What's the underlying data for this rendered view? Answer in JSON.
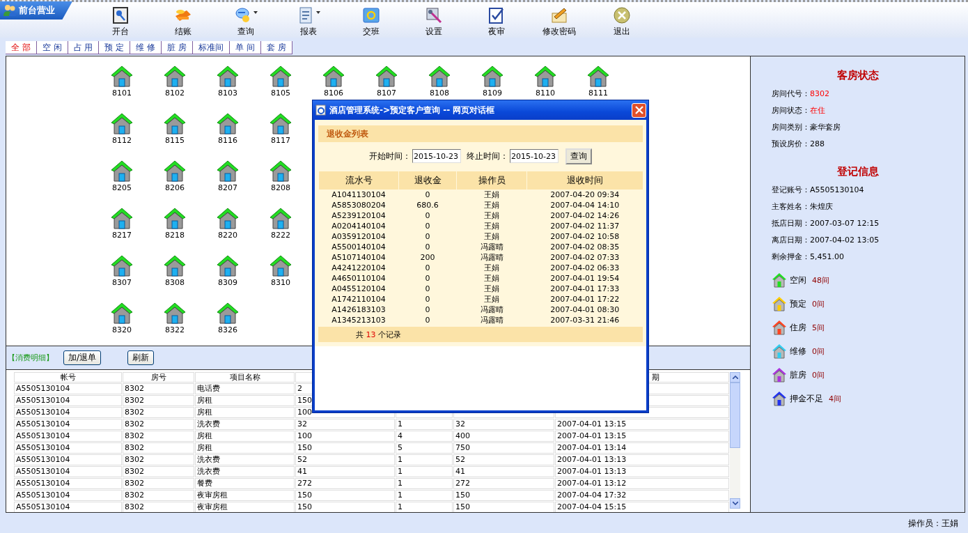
{
  "app_tab": {
    "title": "前台营业"
  },
  "toolbar": [
    {
      "label": "开台",
      "kind": "key",
      "has_menu": false
    },
    {
      "label": "结账",
      "kind": "coins",
      "has_menu": false
    },
    {
      "label": "查询",
      "kind": "chat",
      "has_menu": true
    },
    {
      "label": "报表",
      "kind": "document",
      "has_menu": true
    },
    {
      "label": "交班",
      "kind": "refresh",
      "has_menu": false
    },
    {
      "label": "设置",
      "kind": "tools",
      "has_menu": false
    },
    {
      "label": "夜审",
      "kind": "check",
      "has_menu": false
    },
    {
      "label": "修改密码",
      "kind": "pencil",
      "has_menu": false
    },
    {
      "label": "退出",
      "kind": "exit",
      "has_menu": false
    }
  ],
  "tabs": [
    {
      "label": "全 部",
      "selected": true
    },
    {
      "label": "空 闲",
      "selected": false
    },
    {
      "label": "占 用",
      "selected": false
    },
    {
      "label": "预 定",
      "selected": false
    },
    {
      "label": "维 修",
      "selected": false
    },
    {
      "label": "脏 房",
      "selected": false
    },
    {
      "label": "标准间",
      "selected": false
    },
    {
      "label": "单 间",
      "selected": false
    },
    {
      "label": "套 房",
      "selected": false
    }
  ],
  "room_rows": [
    [
      "8101",
      "8102",
      "8103",
      "8105",
      "8106",
      "8107",
      "8108",
      "8109",
      "8110",
      "8111"
    ],
    [
      "8112",
      "8115",
      "8116",
      "8117"
    ],
    [
      "8205",
      "8206",
      "8207",
      "8208"
    ],
    [
      "8217",
      "8218",
      "8220",
      "8222"
    ],
    [
      "8307",
      "8308",
      "8309",
      "8310"
    ],
    [
      "8320",
      "8322",
      "8326"
    ]
  ],
  "consumption": {
    "title": "【消费明细】",
    "buttons": [
      "加/退单",
      "刷新"
    ],
    "columns": [
      "帐号",
      "房号",
      "项目名称",
      null,
      null,
      null,
      "期"
    ],
    "rows": [
      [
        "A5505130104",
        "8302",
        "电话费",
        "2",
        null,
        null,
        null
      ],
      [
        "A5505130104",
        "8302",
        "房租",
        "150",
        null,
        null,
        null
      ],
      [
        "A5505130104",
        "8302",
        "房租",
        "100",
        null,
        null,
        null
      ],
      [
        "A5505130104",
        "8302",
        "洗衣费",
        "32",
        "1",
        "32",
        "2007-04-01 13:15"
      ],
      [
        "A5505130104",
        "8302",
        "房租",
        "100",
        "4",
        "400",
        "2007-04-01 13:15"
      ],
      [
        "A5505130104",
        "8302",
        "房租",
        "150",
        "5",
        "750",
        "2007-04-01 13:14"
      ],
      [
        "A5505130104",
        "8302",
        "洗衣费",
        "52",
        "1",
        "52",
        "2007-04-01 13:13"
      ],
      [
        "A5505130104",
        "8302",
        "洗衣费",
        "41",
        "1",
        "41",
        "2007-04-01 13:13"
      ],
      [
        "A5505130104",
        "8302",
        "餐费",
        "272",
        "1",
        "272",
        "2007-04-01 13:12"
      ],
      [
        "A5505130104",
        "8302",
        "夜审房租",
        "150",
        "1",
        "150",
        "2007-04-04 17:32"
      ],
      [
        "A5505130104",
        "8302",
        "夜审房租",
        "150",
        "1",
        "150",
        "2007-04-04 15:15"
      ]
    ]
  },
  "room_status": {
    "title": "客房状态",
    "fields": [
      {
        "label": "房间代号：",
        "value": "8302",
        "highlight": true
      },
      {
        "label": "房间状态：",
        "value": "在住",
        "highlight": true
      },
      {
        "label": "房间类别：",
        "value": "豪华套房",
        "highlight": false
      },
      {
        "label": "预设房价：",
        "value": "288",
        "highlight": false
      }
    ]
  },
  "registration": {
    "title": "登记信息",
    "fields": [
      {
        "label": "登记账号：",
        "value": "A5505130104",
        "highlight": false
      },
      {
        "label": "主客姓名：",
        "value": "朱煌庆",
        "highlight": false
      },
      {
        "label": "抵店日期：",
        "value": "2007-03-07 12:15",
        "highlight": false
      },
      {
        "label": "离店日期：",
        "value": "2007-04-02 13:05",
        "highlight": false
      },
      {
        "label": "剩余押金：",
        "value": "5,451.00",
        "highlight": false
      }
    ]
  },
  "legend": [
    {
      "label": "空闲",
      "count": "48间",
      "color": "#22dd22"
    },
    {
      "label": "预定",
      "count": "0间",
      "color": "#ffcc00"
    },
    {
      "label": "住房",
      "count": "5间",
      "color": "#ff4422"
    },
    {
      "label": "维修",
      "count": "0间",
      "color": "#33ccee"
    },
    {
      "label": "脏房",
      "count": "0间",
      "color": "#aa33dd"
    },
    {
      "label": "押金不足",
      "count": "4间",
      "color": "#2233ee"
    }
  ],
  "status_bar": {
    "operator": "操作员：王娟"
  },
  "dialog": {
    "title": "酒店管理系统->预定客户查询 -- 网页对话框",
    "section_title": "退收金列表",
    "start_label": "开始时间：",
    "start_value": "2015-10-23",
    "end_label": "终止时间：",
    "end_value": "2015-10-23",
    "query_button": "查询",
    "columns": [
      "流水号",
      "退收金",
      "操作员",
      "退收时间"
    ],
    "rows": [
      [
        "A1041130104",
        "0",
        "王娟",
        "2007-04-20 09:34"
      ],
      [
        "A5853080204",
        "680.6",
        "王娟",
        "2007-04-04 14:10"
      ],
      [
        "A5239120104",
        "0",
        "王娟",
        "2007-04-02 14:26"
      ],
      [
        "A0204140104",
        "0",
        "王娟",
        "2007-04-02 11:37"
      ],
      [
        "A0359120104",
        "0",
        "王娟",
        "2007-04-02 10:58"
      ],
      [
        "A5500140104",
        "0",
        "冯露晴",
        "2007-04-02 08:35"
      ],
      [
        "A5107140104",
        "200",
        "冯露晴",
        "2007-04-02 07:33"
      ],
      [
        "A4241220104",
        "0",
        "王娟",
        "2007-04-02 06:33"
      ],
      [
        "A4650110104",
        "0",
        "王娟",
        "2007-04-01 19:54"
      ],
      [
        "A0455120104",
        "0",
        "王娟",
        "2007-04-01 17:33"
      ],
      [
        "A1742110104",
        "0",
        "王娟",
        "2007-04-01 17:22"
      ],
      [
        "A1426183103",
        "0",
        "冯露晴",
        "2007-04-01 08:30"
      ],
      [
        "A1345213103",
        "0",
        "冯露晴",
        "2007-03-31 21:46"
      ]
    ],
    "footer": {
      "prefix": "共",
      "count": "13",
      "suffix": "个记录"
    }
  }
}
